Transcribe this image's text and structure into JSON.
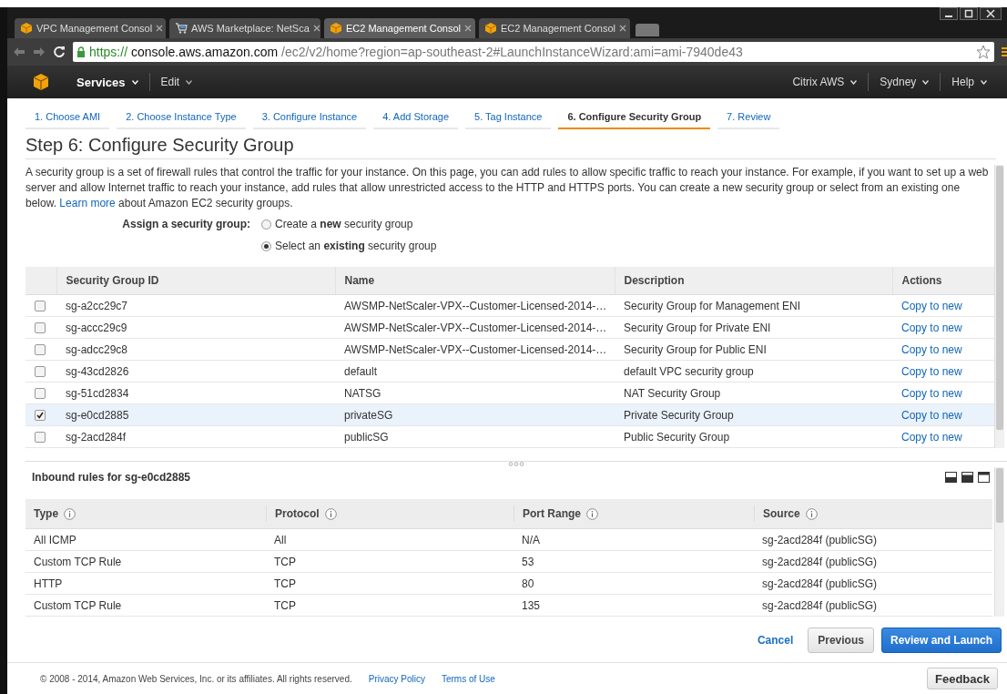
{
  "browser": {
    "tabs": [
      {
        "title": "VPC Management Consol",
        "kind": "box",
        "selected": false
      },
      {
        "title": "AWS Marketplace: NetSca",
        "kind": "cart",
        "selected": false
      },
      {
        "title": "EC2 Management Consol",
        "kind": "box",
        "selected": true
      },
      {
        "title": "EC2 Management Consol",
        "kind": "box",
        "selected": false
      }
    ],
    "url": {
      "scheme": "https://",
      "host": "console.aws.amazon.com",
      "path": "/ec2/v2/home?region=ap-southeast-2#LaunchInstanceWizard:ami=ami-7940de43"
    }
  },
  "nav": {
    "left": [
      "Services",
      "Edit"
    ],
    "right": [
      "Citrix AWS",
      "Sydney",
      "Help"
    ]
  },
  "steps": [
    {
      "label": "1. Choose AMI",
      "selected": false
    },
    {
      "label": "2. Choose Instance Type",
      "selected": false
    },
    {
      "label": "3. Configure Instance",
      "selected": false
    },
    {
      "label": "4. Add Storage",
      "selected": false
    },
    {
      "label": "5. Tag Instance",
      "selected": false
    },
    {
      "label": "6. Configure Security Group",
      "selected": true
    },
    {
      "label": "7. Review",
      "selected": false
    }
  ],
  "heading": "Step 6: Configure Security Group",
  "intro": {
    "text": "A security group is a set of firewall rules that control the traffic for your instance. On this page, you can add rules to allow specific traffic to reach your instance. For example, if you want to set up a web server and allow Internet traffic to reach your instance, add rules that allow unrestricted access to the HTTP and HTTPS ports. You can create a new security group or select from an existing one below.",
    "link": "Learn more",
    "after": "about Amazon EC2 security groups."
  },
  "assign": {
    "label": "Assign a security group:",
    "options": [
      {
        "label": "Create a **new** security group",
        "selected": false
      },
      {
        "label": "Select an **existing** security group",
        "selected": true
      }
    ]
  },
  "security_groups": {
    "columns": [
      "Security Group ID",
      "Name",
      "Description",
      "Actions"
    ],
    "rows": [
      {
        "id": "sg-a2cc29c7",
        "name": "AWSMP-NetScaler-VPX--Customer-Licensed-2014-…",
        "description": "Security Group for Management ENI",
        "action": "Copy to new",
        "checked": false
      },
      {
        "id": "sg-accc29c9",
        "name": "AWSMP-NetScaler-VPX--Customer-Licensed-2014-…",
        "description": "Security Group for Private ENI",
        "action": "Copy to new",
        "checked": false
      },
      {
        "id": "sg-adcc29c8",
        "name": "AWSMP-NetScaler-VPX--Customer-Licensed-2014-…",
        "description": "Security Group for Public ENI",
        "action": "Copy to new",
        "checked": false
      },
      {
        "id": "sg-43cd2826",
        "name": "default",
        "description": "default VPC security group",
        "action": "Copy to new",
        "checked": false
      },
      {
        "id": "sg-51cd2834",
        "name": "NATSG",
        "description": "NAT Security Group",
        "action": "Copy to new",
        "checked": false
      },
      {
        "id": "sg-e0cd2885",
        "name": "privateSG",
        "description": "Private Security Group",
        "action": "Copy to new",
        "checked": true
      },
      {
        "id": "sg-2acd284f",
        "name": "publicSG",
        "description": "Public Security Group",
        "action": "Copy to new",
        "checked": false
      }
    ]
  },
  "inbound": {
    "title": "Inbound rules for sg-e0cd2885",
    "columns": [
      "Type",
      "Protocol",
      "Port Range",
      "Source"
    ],
    "rows": [
      {
        "type": "All ICMP",
        "protocol": "All",
        "port_range": "N/A",
        "source": "sg-2acd284f (publicSG)"
      },
      {
        "type": "Custom TCP Rule",
        "protocol": "TCP",
        "port_range": "53",
        "source": "sg-2acd284f (publicSG)"
      },
      {
        "type": "HTTP",
        "protocol": "TCP",
        "port_range": "80",
        "source": "sg-2acd284f (publicSG)"
      },
      {
        "type": "Custom TCP Rule",
        "protocol": "TCP",
        "port_range": "135",
        "source": "sg-2acd284f (publicSG)"
      }
    ]
  },
  "buttons": {
    "cancel": "Cancel",
    "previous": "Previous",
    "primary": "Review and Launch"
  },
  "footer": {
    "copyright": "© 2008 - 2014, Amazon Web Services, Inc. or its affiliates. All rights reserved.",
    "links": [
      "Privacy Policy",
      "Terms of Use"
    ],
    "feedback": "Feedback"
  }
}
